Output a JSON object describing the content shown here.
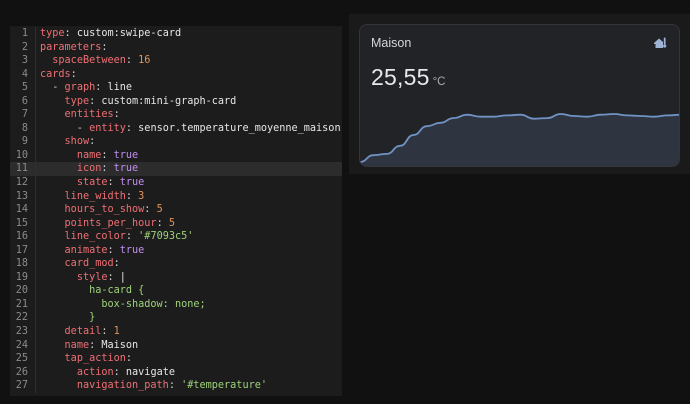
{
  "editor": {
    "active_line": 11,
    "lines": [
      {
        "num": "1",
        "indent": "",
        "key": "type",
        "value": "custom:swipe-card",
        "vtype": "v"
      },
      {
        "num": "2",
        "indent": "",
        "key": "parameters",
        "value": "",
        "vtype": "v"
      },
      {
        "num": "3",
        "indent": "  ",
        "key": "spaceBetween",
        "value": "16",
        "vtype": "n"
      },
      {
        "num": "4",
        "indent": "",
        "key": "cards",
        "value": "",
        "vtype": "v"
      },
      {
        "num": "5",
        "indent": "  - ",
        "key": "graph",
        "value": "line",
        "vtype": "v"
      },
      {
        "num": "6",
        "indent": "    ",
        "key": "type",
        "value": "custom:mini-graph-card",
        "vtype": "v"
      },
      {
        "num": "7",
        "indent": "    ",
        "key": "entities",
        "value": "",
        "vtype": "v"
      },
      {
        "num": "8",
        "indent": "      - ",
        "key": "entity",
        "value": "sensor.temperature_moyenne_maison",
        "vtype": "v"
      },
      {
        "num": "9",
        "indent": "    ",
        "key": "show",
        "value": "",
        "vtype": "v"
      },
      {
        "num": "10",
        "indent": "      ",
        "key": "name",
        "value": "true",
        "vtype": "b"
      },
      {
        "num": "11",
        "indent": "      ",
        "key": "icon",
        "value": "true",
        "vtype": "b"
      },
      {
        "num": "12",
        "indent": "      ",
        "key": "state",
        "value": "true",
        "vtype": "b"
      },
      {
        "num": "13",
        "indent": "    ",
        "key": "line_width",
        "value": "3",
        "vtype": "n"
      },
      {
        "num": "14",
        "indent": "    ",
        "key": "hours_to_show",
        "value": "5",
        "vtype": "n"
      },
      {
        "num": "15",
        "indent": "    ",
        "key": "points_per_hour",
        "value": "5",
        "vtype": "n"
      },
      {
        "num": "16",
        "indent": "    ",
        "key": "line_color",
        "value": "'#7093c5'",
        "vtype": "s"
      },
      {
        "num": "17",
        "indent": "    ",
        "key": "animate",
        "value": "true",
        "vtype": "b"
      },
      {
        "num": "18",
        "indent": "    ",
        "key": "card_mod",
        "value": "",
        "vtype": "v"
      },
      {
        "num": "19",
        "indent": "      ",
        "key": "style",
        "value": "|",
        "vtype": "v"
      },
      {
        "num": "20",
        "indent": "        ",
        "key": "",
        "value": "ha-card {",
        "vtype": "s"
      },
      {
        "num": "21",
        "indent": "          ",
        "key": "",
        "value": "box-shadow: none;",
        "vtype": "s"
      },
      {
        "num": "22",
        "indent": "        ",
        "key": "",
        "value": "}",
        "vtype": "s"
      },
      {
        "num": "23",
        "indent": "    ",
        "key": "detail",
        "value": "1",
        "vtype": "n"
      },
      {
        "num": "24",
        "indent": "    ",
        "key": "name",
        "value": "Maison",
        "vtype": "v"
      },
      {
        "num": "25",
        "indent": "    ",
        "key": "tap_action",
        "value": "",
        "vtype": "v"
      },
      {
        "num": "26",
        "indent": "      ",
        "key": "action",
        "value": "navigate",
        "vtype": "v"
      },
      {
        "num": "27",
        "indent": "      ",
        "key": "navigation_path",
        "value": "'#temperature'",
        "vtype": "s"
      }
    ]
  },
  "card": {
    "name": "Maison",
    "icon": "home-thermometer-icon",
    "state": "25,55",
    "unit": "°C",
    "line_color": "#7093c5",
    "fill_color": "#2f3540",
    "graph_values": [
      18.6,
      19.6,
      19.8,
      21.0,
      22.6,
      23.9,
      24.4,
      25.1,
      25.6,
      25.3,
      25.3,
      25.5,
      25.6,
      25.0,
      25.1,
      25.7,
      25.4,
      25.3,
      25.6,
      25.7,
      25.5,
      25.4,
      25.3,
      25.5,
      25.6
    ]
  }
}
